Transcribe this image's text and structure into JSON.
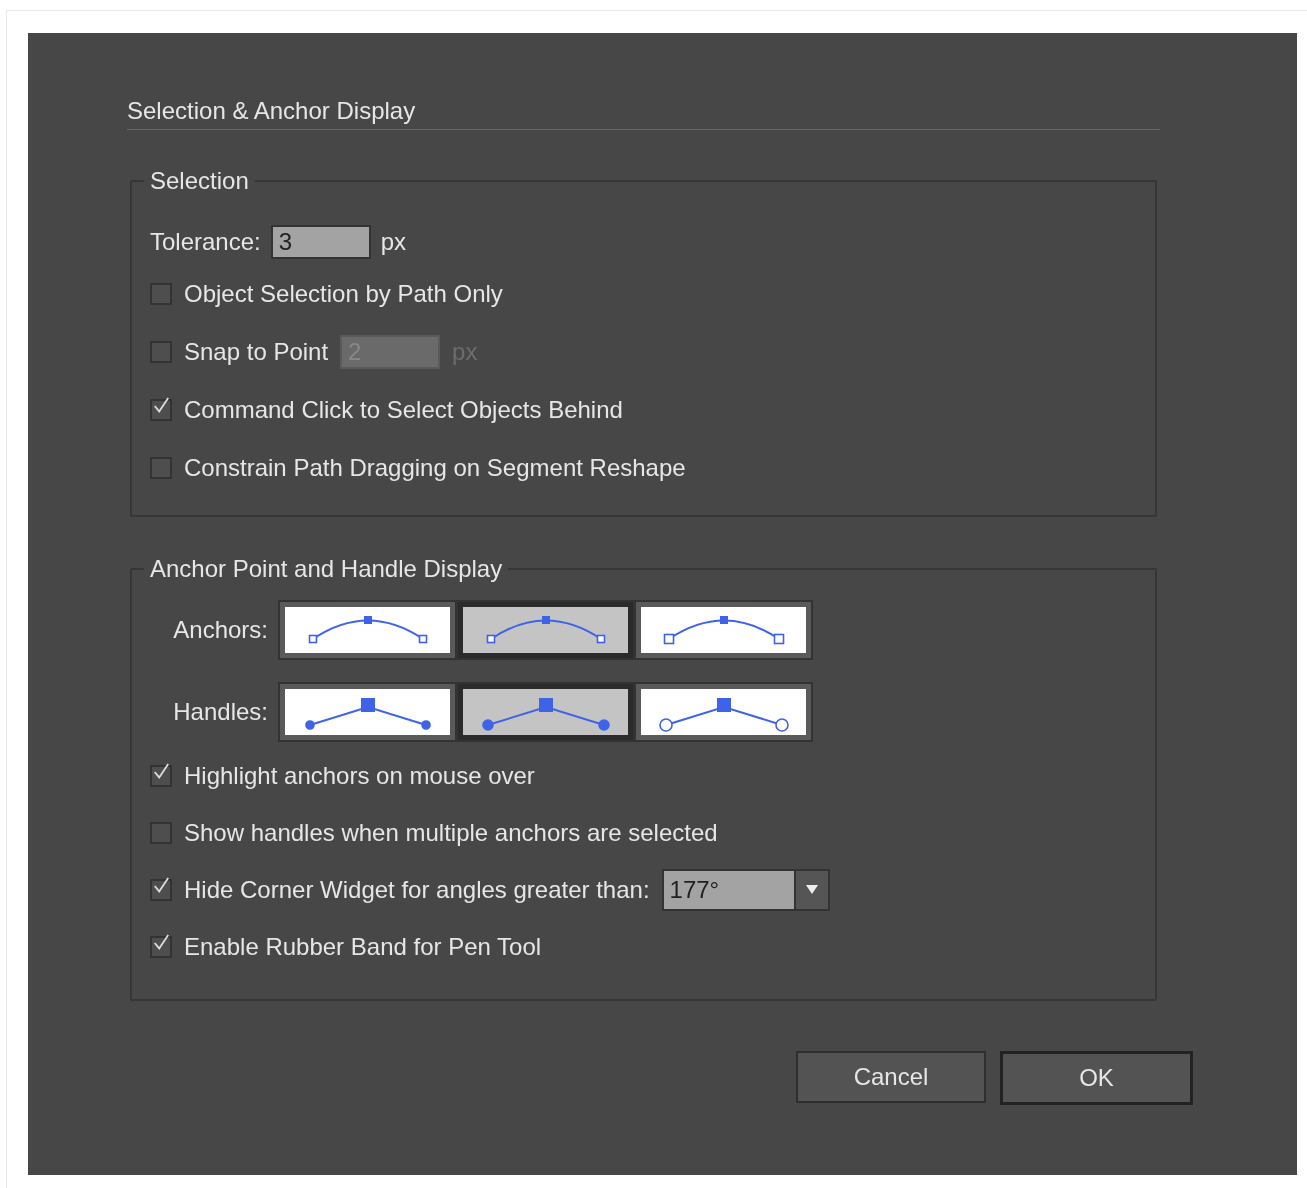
{
  "title": "Selection & Anchor Display",
  "selection": {
    "legend": "Selection",
    "tolerance": {
      "label": "Tolerance:",
      "value": "3",
      "unit": "px"
    },
    "rows": [
      {
        "kind": "checkbox",
        "label": "Object Selection by Path Only",
        "checked": false
      },
      {
        "kind": "checkbox-field",
        "label": "Snap to Point",
        "checked": false,
        "value": "2",
        "unit": "px",
        "disabled": true
      },
      {
        "kind": "checkbox",
        "label": "Command Click to Select Objects Behind",
        "checked": true
      },
      {
        "kind": "checkbox",
        "label": "Constrain Path Dragging on Segment Reshape",
        "checked": false
      }
    ]
  },
  "anchor_display": {
    "legend": "Anchor Point and Handle Display",
    "pickers": [
      {
        "label": "Anchors:",
        "kind": "anchors",
        "options": [
          {
            "kind": "small",
            "selected": false
          },
          {
            "kind": "medium",
            "selected": true
          },
          {
            "kind": "large",
            "selected": false
          }
        ]
      },
      {
        "label": "Handles:",
        "kind": "handles",
        "options": [
          {
            "kind": "small",
            "selected": false
          },
          {
            "kind": "medium",
            "selected": true
          },
          {
            "kind": "hollow",
            "selected": false
          }
        ]
      }
    ],
    "rows": [
      {
        "kind": "checkbox",
        "label": "Highlight anchors on mouse over",
        "checked": true
      },
      {
        "kind": "checkbox",
        "label": "Show handles when multiple anchors are selected",
        "checked": false
      },
      {
        "kind": "checkbox-dropdown",
        "label": "Hide Corner Widget for angles greater than:",
        "checked": true,
        "value": "177°"
      },
      {
        "kind": "checkbox",
        "label": "Enable Rubber Band for Pen Tool",
        "checked": true
      }
    ]
  },
  "buttons": [
    {
      "label": "Cancel",
      "default": false
    },
    {
      "label": "OK",
      "default": true
    }
  ]
}
